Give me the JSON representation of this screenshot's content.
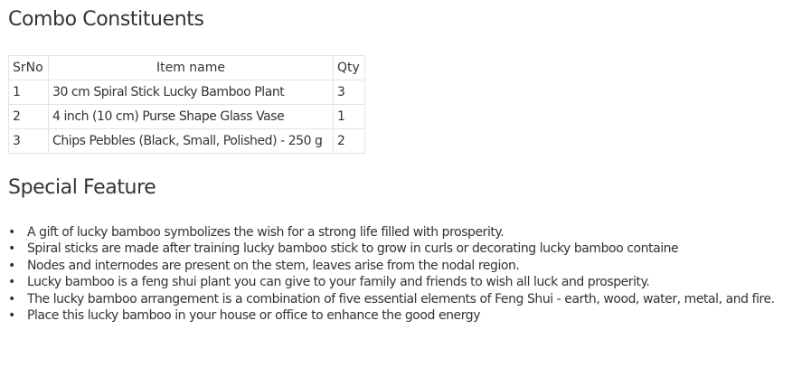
{
  "combo": {
    "title": "Combo Constituents",
    "columns": [
      "SrNo",
      "Item name",
      "Qty"
    ],
    "rows": [
      {
        "srno": "1",
        "name": "30 cm Spiral Stick Lucky Bamboo Plant",
        "qty": "3"
      },
      {
        "srno": "2",
        "name": "4 inch (10 cm) Purse Shape Glass Vase",
        "qty": "1"
      },
      {
        "srno": "3",
        "name": "Chips Pebbles (Black, Small, Polished) - 250 g",
        "qty": "2"
      }
    ]
  },
  "special": {
    "title": "Special Feature",
    "bullet": "•",
    "items": [
      "A gift of lucky bamboo symbolizes the wish for a strong life filled with prosperity.",
      "Spiral sticks are made after training lucky bamboo stick to grow in curls or decorating lucky bamboo containe",
      "Nodes and internodes are present on the stem, leaves arise from the nodal region.",
      "Lucky bamboo is a feng shui plant you can give to your family and friends to wish all luck and prosperity.",
      "The lucky bamboo arrangement is a combination of five essential elements of Feng Shui - earth, wood, water, metal, and fire.",
      "Place this lucky bamboo in your house or office to enhance the good energy"
    ]
  },
  "colors": {
    "text": "#333333",
    "table_border": "#e3e3e3",
    "background": "#ffffff"
  }
}
